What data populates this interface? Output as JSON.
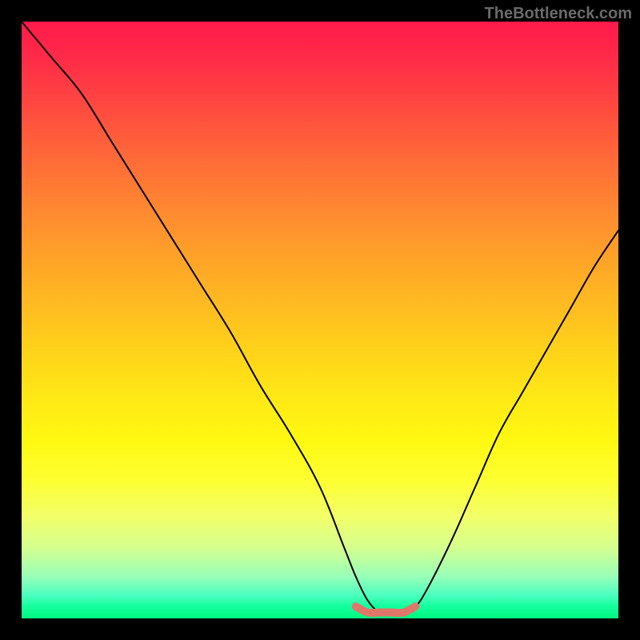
{
  "watermark": "TheBottleneck.com",
  "chart_data": {
    "type": "line",
    "title": "",
    "xlabel": "",
    "ylabel": "",
    "xlim": [
      0,
      100
    ],
    "ylim": [
      0,
      100
    ],
    "series": [
      {
        "name": "bottleneck-curve",
        "x": [
          0,
          5,
          10,
          15,
          20,
          25,
          30,
          35,
          40,
          45,
          50,
          54,
          56,
          58,
          60,
          62,
          64,
          66,
          68,
          72,
          76,
          80,
          84,
          88,
          92,
          96,
          100
        ],
        "values": [
          100,
          94,
          88,
          80,
          72,
          64,
          56,
          48,
          39,
          31,
          22,
          12,
          7,
          3,
          1,
          1,
          1,
          2,
          5,
          13,
          22,
          31,
          38,
          45,
          52,
          59,
          65
        ]
      },
      {
        "name": "highlight-band",
        "x": [
          56,
          58,
          60,
          62,
          64,
          66
        ],
        "values": [
          2,
          1,
          1,
          1,
          1,
          2
        ]
      }
    ],
    "gradient_colors": {
      "top": "#ff1a4a",
      "mid": "#ffe816",
      "bottom": "#00f77e"
    },
    "highlight_color": "#e0766a"
  }
}
